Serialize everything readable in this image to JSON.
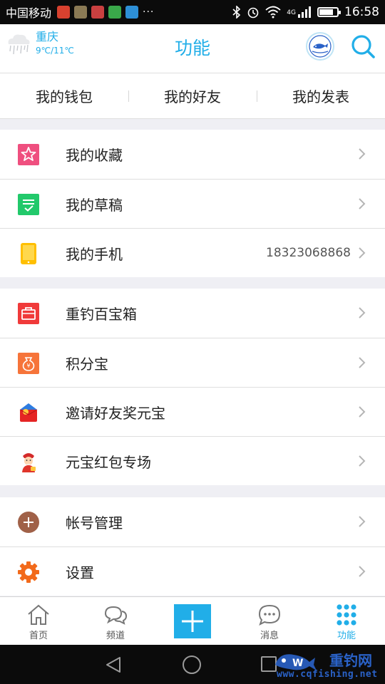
{
  "status_bar": {
    "carrier": "中国移动",
    "more_indicator": "···",
    "network": "4G",
    "time": "16:58",
    "battery_level": 0.8
  },
  "header": {
    "weather_city": "重庆",
    "weather_temp": "9℃/11℃",
    "title": "功能",
    "accent": "#21aee8"
  },
  "quick_tabs": [
    "我的钱包",
    "我的好友",
    "我的发表"
  ],
  "groups": [
    {
      "rows": [
        {
          "label": "我的收藏",
          "icon": "star-icon"
        },
        {
          "label": "我的草稿",
          "icon": "draft-icon"
        },
        {
          "label": "我的手机",
          "icon": "phone-icon",
          "value": "18323068868"
        }
      ]
    },
    {
      "rows": [
        {
          "label": "重钓百宝箱",
          "icon": "toolbox-icon"
        },
        {
          "label": "积分宝",
          "icon": "points-bag-icon"
        },
        {
          "label": "邀请好友奖元宝",
          "icon": "red-envelope-icon"
        },
        {
          "label": "元宝红包专场",
          "icon": "god-of-wealth-icon"
        }
      ]
    },
    {
      "rows": [
        {
          "label": "帐号管理",
          "icon": "plus-circle-icon"
        },
        {
          "label": "设置",
          "icon": "gear-icon"
        }
      ]
    }
  ],
  "bottom_nav": [
    {
      "label": "首页",
      "icon": "home-icon"
    },
    {
      "label": "频道",
      "icon": "channel-icon"
    },
    {
      "label": "",
      "icon": "add-icon"
    },
    {
      "label": "消息",
      "icon": "message-icon"
    },
    {
      "label": "功能",
      "icon": "grid-icon",
      "active": true
    }
  ],
  "watermark": {
    "name": "重钓网",
    "url": "www.cqfishing.net"
  }
}
